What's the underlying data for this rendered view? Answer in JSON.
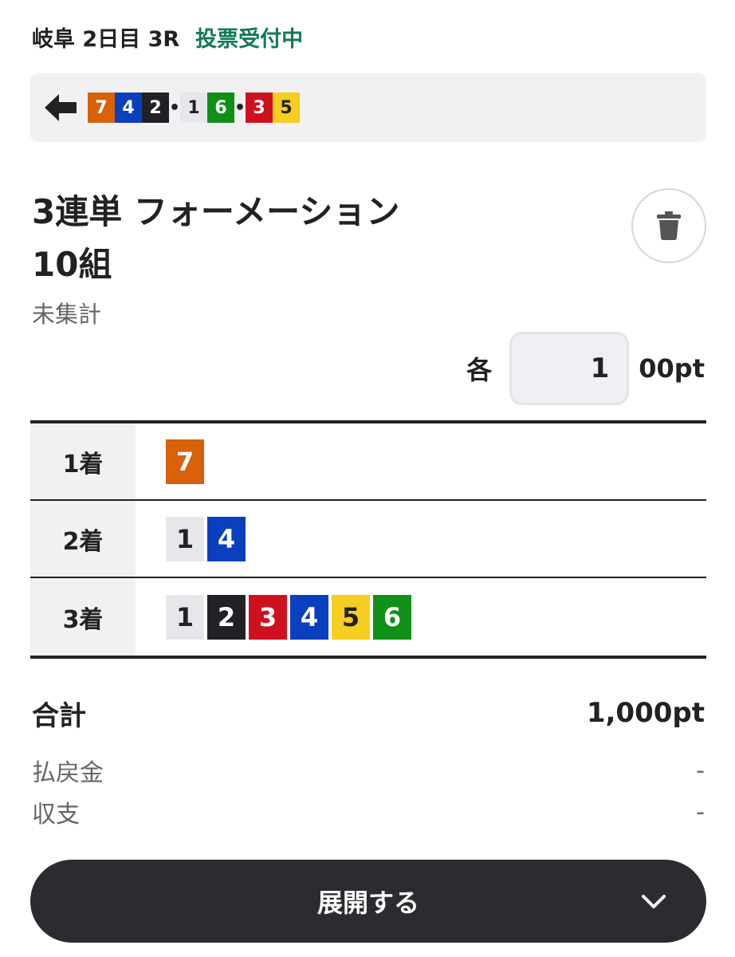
{
  "header": {
    "race": "岐阜 2日目 3R",
    "status": "投票受付中"
  },
  "line": {
    "groups": [
      [
        {
          "n": "7",
          "c": "c7"
        },
        {
          "n": "4",
          "c": "c4"
        },
        {
          "n": "2",
          "c": "c2"
        }
      ],
      [
        {
          "n": "1",
          "c": "c1"
        },
        {
          "n": "6",
          "c": "c6"
        }
      ],
      [
        {
          "n": "3",
          "c": "c3"
        },
        {
          "n": "5",
          "c": "c5"
        }
      ]
    ],
    "separator": "•"
  },
  "bet": {
    "type": "3連単 フォーメーション",
    "count": "10組",
    "tally": "未集計"
  },
  "stake": {
    "label": "各",
    "value": "1",
    "unit": "00pt"
  },
  "formation": [
    {
      "label": "1着",
      "chips": [
        {
          "n": "7",
          "c": "c7"
        }
      ]
    },
    {
      "label": "2着",
      "chips": [
        {
          "n": "1",
          "c": "c1"
        },
        {
          "n": "4",
          "c": "c4"
        }
      ]
    },
    {
      "label": "3着",
      "chips": [
        {
          "n": "1",
          "c": "c1"
        },
        {
          "n": "2",
          "c": "c2"
        },
        {
          "n": "3",
          "c": "c3"
        },
        {
          "n": "4",
          "c": "c4"
        },
        {
          "n": "5",
          "c": "c5"
        },
        {
          "n": "6",
          "c": "c6"
        }
      ]
    }
  ],
  "summary": {
    "total_label": "合計",
    "total_value": "1,000pt",
    "payout_label": "払戻金",
    "payout_value": "-",
    "balance_label": "収支",
    "balance_value": "-"
  },
  "expand_label": "展開する",
  "icons": {
    "back": "arrow-left-icon",
    "delete": "trash-icon",
    "expand": "chevron-down-icon"
  }
}
